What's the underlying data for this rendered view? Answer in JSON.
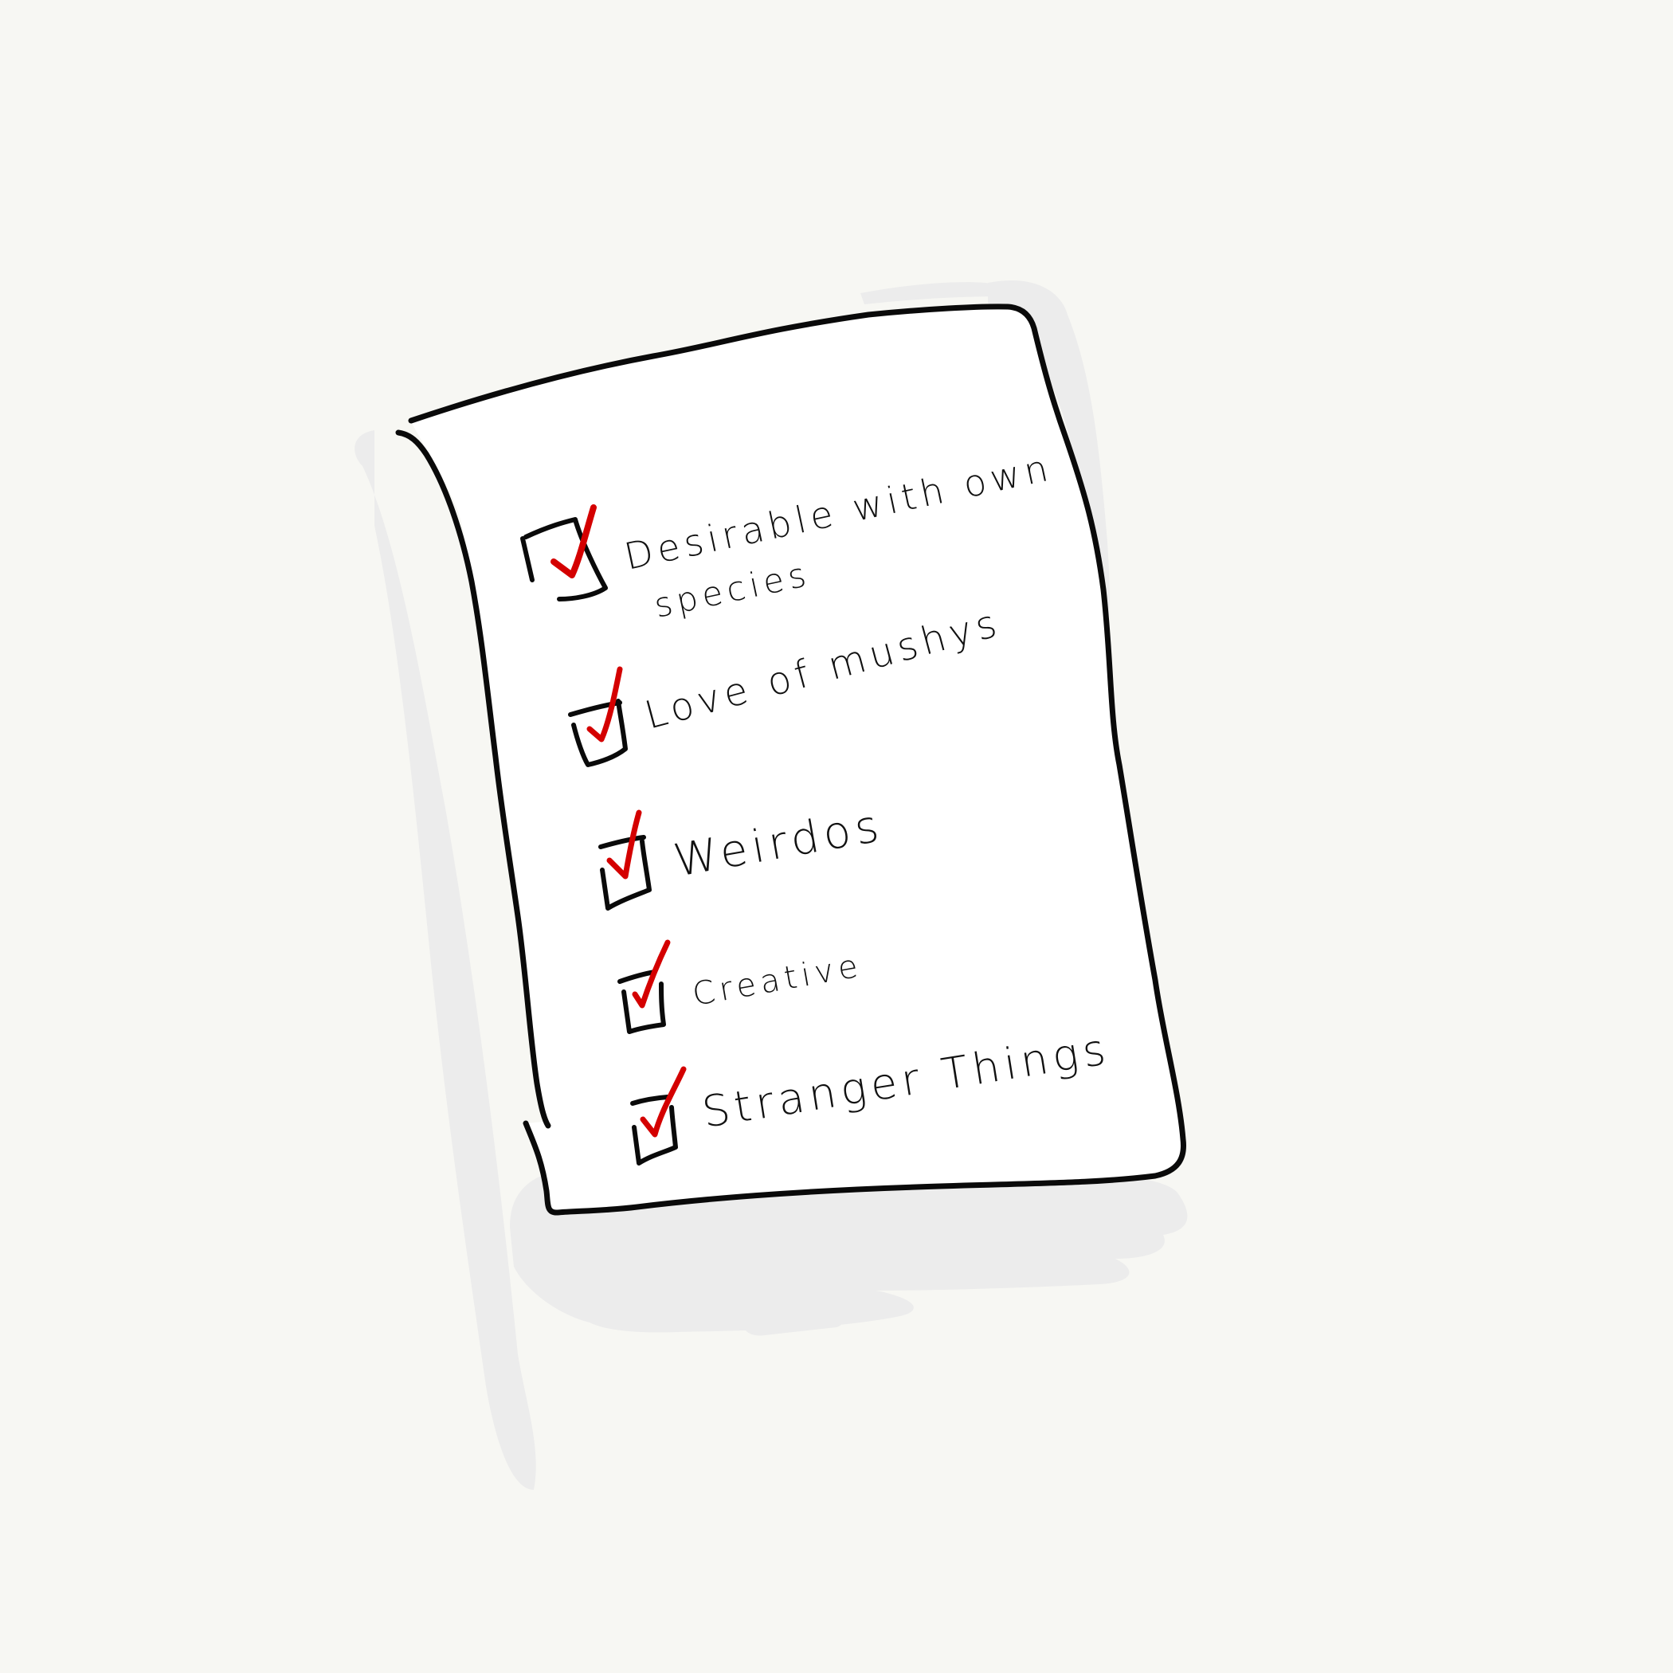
{
  "checklist": {
    "items": [
      {
        "line1": "Desirable  with own",
        "line2": "species",
        "checked": true
      },
      {
        "line1": "Love  of mushys",
        "checked": true
      },
      {
        "line1": "Weirdos",
        "checked": true
      },
      {
        "line1": "Creative",
        "checked": true
      },
      {
        "line1": "Stranger Things",
        "checked": true
      }
    ]
  },
  "colors": {
    "background": "#f7f7f3",
    "paper": "#ffffff",
    "outline": "#0a0a0a",
    "check": "#d40000",
    "shadow": "#ececec"
  }
}
